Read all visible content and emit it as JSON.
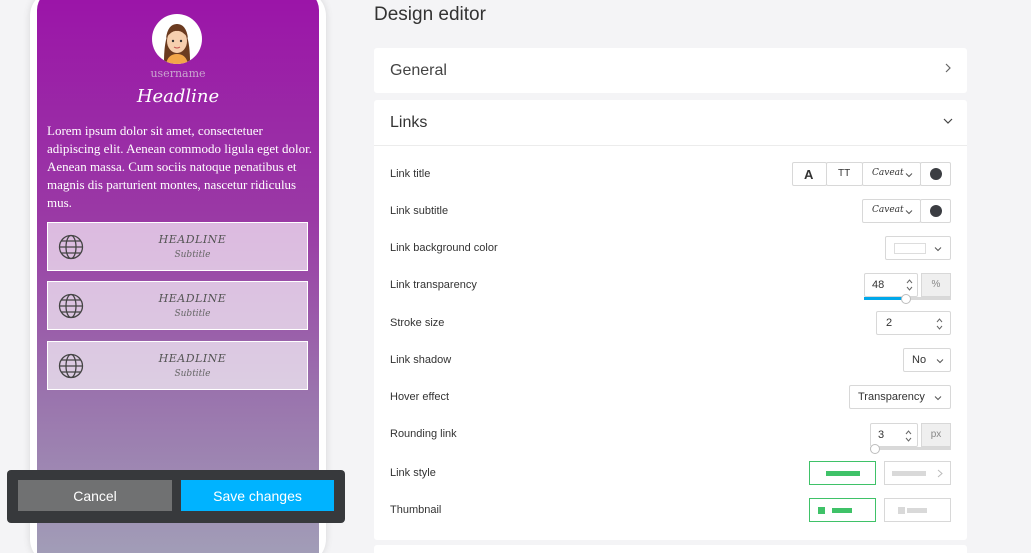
{
  "preview": {
    "username": "username",
    "headline": "Headline",
    "bio": "Lorem ipsum dolor sit amet, consectetuer adipiscing elit. Aenean commodo ligula eget dolor. Aenean massa. Cum sociis natoque penatibus et magnis dis parturient montes, nascetur ridiculus mus.",
    "links": [
      {
        "title": "HEADLINE",
        "subtitle": "Subtitle",
        "icon": "globe-icon"
      },
      {
        "title": "HEADLINE",
        "subtitle": "Subtitle",
        "icon": "globe-icon"
      },
      {
        "title": "HEADLINE",
        "subtitle": "Subtitle",
        "icon": "globe-icon"
      }
    ]
  },
  "savebar": {
    "cancel_label": "Cancel",
    "save_label": "Save changes"
  },
  "editor": {
    "title": "Design editor",
    "general": {
      "title": "General"
    },
    "links": {
      "title": "Links",
      "link_title": {
        "label": "Link title",
        "bold_glyph": "A",
        "caps_glyph": "TT",
        "font": "Caveat"
      },
      "link_subtitle": {
        "label": "Link subtitle",
        "font": "Caveat"
      },
      "link_bg_color": {
        "label": "Link background color"
      },
      "link_transparency": {
        "label": "Link transparency",
        "value": "48",
        "unit": "%"
      },
      "stroke_size": {
        "label": "Stroke size",
        "value": "2"
      },
      "link_shadow": {
        "label": "Link shadow",
        "value": "No"
      },
      "hover_effect": {
        "label": "Hover effect",
        "value": "Transparency"
      },
      "rounding_link": {
        "label": "Rounding link",
        "value": "3",
        "unit": "px"
      },
      "link_style": {
        "label": "Link style"
      },
      "thumbnail": {
        "label": "Thumbnail"
      }
    }
  },
  "colors": {
    "accent": "#00b3ff",
    "selected": "#3fc268",
    "text_dot": "#3b3d42"
  }
}
